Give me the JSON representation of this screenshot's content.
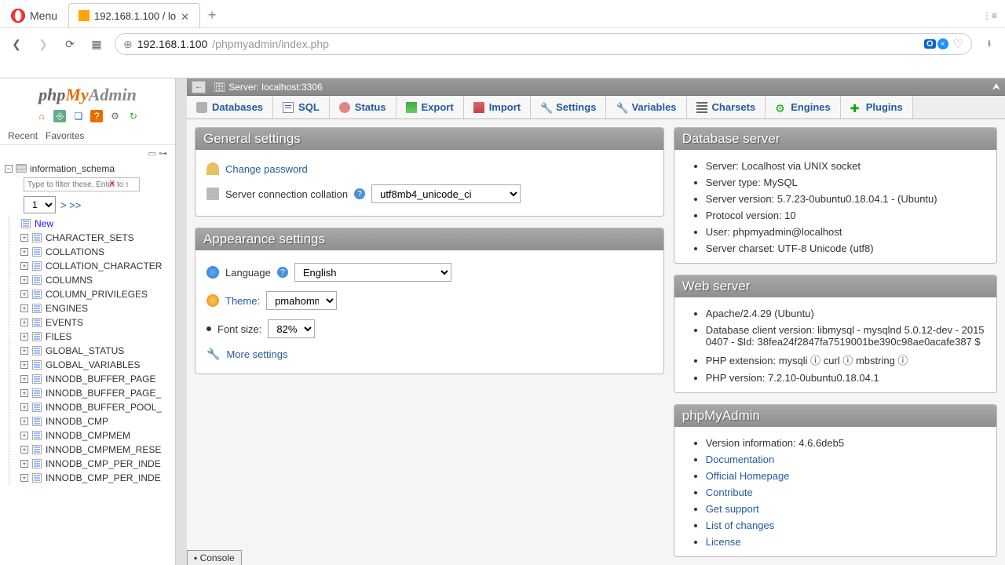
{
  "browser": {
    "menu_label": "Menu",
    "tab_title": "192.168.1.100 / lo",
    "url_host": "192.168.1.100",
    "url_path": "/phpmyadmin/index.php",
    "badge1": "O",
    "badge2": "×"
  },
  "logo": {
    "p1": "php",
    "p2": "My",
    "p3": "Admin"
  },
  "side_tabs": {
    "recent": "Recent",
    "favorites": "Favorites"
  },
  "db_name": "information_schema",
  "filter_placeholder": "Type to filter these, Enter to searc",
  "page_sel": "1",
  "pager_next": "> >>",
  "new_label": "New",
  "tables": [
    "CHARACTER_SETS",
    "COLLATIONS",
    "COLLATION_CHARACTER",
    "COLUMNS",
    "COLUMN_PRIVILEGES",
    "ENGINES",
    "EVENTS",
    "FILES",
    "GLOBAL_STATUS",
    "GLOBAL_VARIABLES",
    "INNODB_BUFFER_PAGE",
    "INNODB_BUFFER_PAGE_",
    "INNODB_BUFFER_POOL_",
    "INNODB_CMP",
    "INNODB_CMPMEM",
    "INNODB_CMPMEM_RESE",
    "INNODB_CMP_PER_INDE",
    "INNODB_CMP_PER_INDE"
  ],
  "server_bar": {
    "label": "Server: localhost:3306"
  },
  "top_tabs": [
    {
      "label": "Databases",
      "ic": "tt-db"
    },
    {
      "label": "SQL",
      "ic": "tt-sql"
    },
    {
      "label": "Status",
      "ic": "tt-status"
    },
    {
      "label": "Export",
      "ic": "tt-export"
    },
    {
      "label": "Import",
      "ic": "tt-import"
    },
    {
      "label": "Settings",
      "ic": "tt-settings",
      "glyph": "🔧"
    },
    {
      "label": "Variables",
      "ic": "tt-vars",
      "glyph": "🔧"
    },
    {
      "label": "Charsets",
      "ic": "tt-charsets"
    },
    {
      "label": "Engines",
      "ic": "tt-engines",
      "glyph": "⚙"
    },
    {
      "label": "Plugins",
      "ic": "tt-plugins",
      "glyph": "✚"
    }
  ],
  "general": {
    "title": "General settings",
    "change_pw": "Change password",
    "collation_label": "Server connection collation",
    "collation_value": "utf8mb4_unicode_ci"
  },
  "appearance": {
    "title": "Appearance settings",
    "lang_label": "Language",
    "lang_value": "English",
    "theme_label": "Theme:",
    "theme_value": "pmahomme",
    "font_label": "Font size:",
    "font_value": "82%",
    "more": "More settings"
  },
  "db_server": {
    "title": "Database server",
    "items": [
      "Server: Localhost via UNIX socket",
      "Server type: MySQL",
      "Server version: 5.7.23-0ubuntu0.18.04.1 - (Ubuntu)",
      "Protocol version: 10",
      "User: phpmyadmin@localhost",
      "Server charset: UTF-8 Unicode (utf8)"
    ]
  },
  "web_server": {
    "title": "Web server",
    "items": [
      "Apache/2.4.29 (Ubuntu)",
      "Database client version: libmysql - mysqlnd 5.0.12-dev - 20150407 - $Id: 38fea24f2847fa7519001be390c98ae0acafe387 $",
      "PHP extension: mysqli ⓘ curl ⓘ mbstring ⓘ",
      "PHP version: 7.2.10-0ubuntu0.18.04.1"
    ]
  },
  "pma_info": {
    "title": "phpMyAdmin",
    "version": "Version information: 4.6.6deb5",
    "links": [
      "Documentation",
      "Official Homepage",
      "Contribute",
      "Get support",
      "List of changes",
      "License"
    ]
  },
  "console": "Console"
}
